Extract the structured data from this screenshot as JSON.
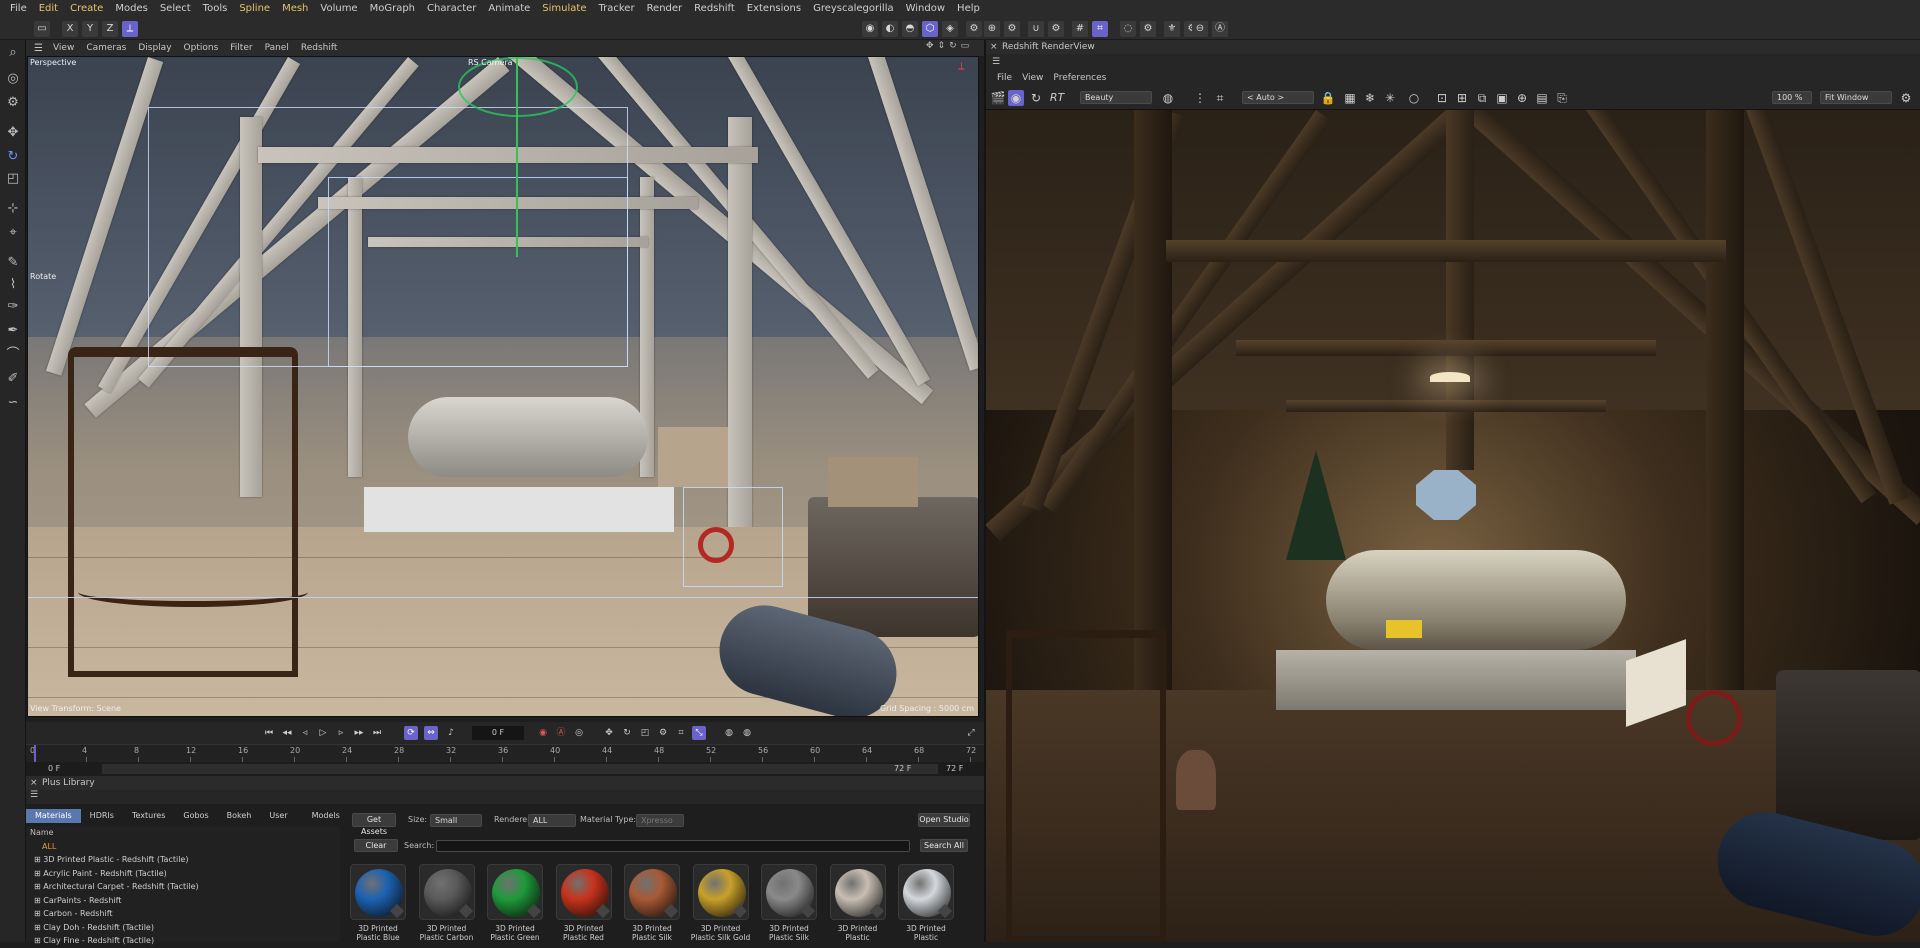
{
  "menu": [
    "File",
    "Edit",
    "Create",
    "Modes",
    "Select",
    "Tools",
    "Spline",
    "Mesh",
    "Volume",
    "MoGraph",
    "Character",
    "Animate",
    "Simulate",
    "Tracker",
    "Render",
    "Redshift",
    "Extensions",
    "Greyscalegorilla",
    "Window",
    "Help"
  ],
  "axis_buttons": [
    "X",
    "Y",
    "Z"
  ],
  "viewport_menu": [
    "View",
    "Cameras",
    "Display",
    "Options",
    "Filter",
    "Panel",
    "Redshift"
  ],
  "viewport": {
    "name": "Perspective",
    "camera_label": "RS Camera",
    "tool_label": "Rotate",
    "view_transform": "View Transform: Scene",
    "grid_spacing": "Grid Spacing : 5000 cm"
  },
  "timeline": {
    "current_frame": "0 F",
    "ticks": [
      "0",
      "4",
      "8",
      "12",
      "16",
      "20",
      "24",
      "28",
      "32",
      "36",
      "40",
      "44",
      "48",
      "52",
      "56",
      "60",
      "64",
      "68",
      "72"
    ],
    "start_a": "0 F",
    "start_b": "0 F",
    "end_a": "72 F",
    "end_b": "72 F"
  },
  "plus_library": {
    "title": "Plus Library",
    "tabs": [
      "Materials",
      "HDRIs",
      "Textures",
      "Gobos",
      "Bokeh",
      "User HDRIs",
      "Models"
    ],
    "active_tab": "Materials",
    "list_header": "Name",
    "all_label": "ALL",
    "categories": [
      "3D Printed Plastic - Redshift (Tactile)",
      "Acrylic Paint - Redshift (Tactile)",
      "Architectural Carpet - Redshift (Tactile)",
      "CarPaints - Redshift",
      "Carbon - Redshift",
      "Clay Doh - Redshift (Tactile)",
      "Clay Fine - Redshift (Tactile)"
    ],
    "get_assets": "Get Assets",
    "size_label": "Size:",
    "size_value": "Small",
    "renderer_label": "Renderer:",
    "renderer_value": "ALL",
    "material_type_label": "Material Type:",
    "material_type_value": "Xpresso",
    "open_studio": "Open Studio",
    "clear": "Clear",
    "search_label": "Search:",
    "search_value": "",
    "search_all": "Search All",
    "materials": [
      {
        "label": "3D Printed Plastic Blue",
        "color": "#1c62b3"
      },
      {
        "label": "3D Printed Plastic Carbon",
        "color": "#5a5a5a"
      },
      {
        "label": "3D Printed Plastic Green",
        "color": "#1f9a3a"
      },
      {
        "label": "3D Printed Plastic Red",
        "color": "#c8331b"
      },
      {
        "label": "3D Printed Plastic Silk",
        "color": "#a85a35"
      },
      {
        "label": "3D Printed Plastic Silk Gold",
        "color": "#c9a02a"
      },
      {
        "label": "3D Printed Plastic Silk",
        "color": "#8a8a8a"
      },
      {
        "label": "3D Printed Plastic",
        "color": "#c8bfb3"
      },
      {
        "label": "3D Printed Plastic",
        "color": "#d4d8dc"
      }
    ]
  },
  "render_view": {
    "title": "Redshift RenderView",
    "menu": [
      "File",
      "View",
      "Preferences"
    ],
    "rt_label": "RT",
    "aov_value": "Beauty",
    "camera_value": "< Auto >",
    "zoom_value": "100 %",
    "fit_value": "Fit Window"
  },
  "colors": {
    "accent": "#6a63c9",
    "menu_highlight": "#e6c46a",
    "active_tab": "#5a78b0",
    "all_label": "#e59a3a"
  }
}
